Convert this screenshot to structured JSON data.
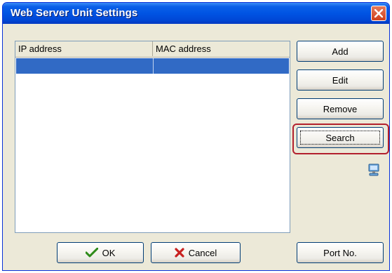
{
  "window": {
    "title": "Web Server Unit Settings"
  },
  "list": {
    "columns": [
      "IP address",
      "MAC address"
    ],
    "rows": [
      {
        "ip": "",
        "mac": "",
        "selected": true
      }
    ]
  },
  "buttons": {
    "add": "Add",
    "edit": "Edit",
    "remove": "Remove",
    "search": "Search",
    "ok": "OK",
    "cancel": "Cancel",
    "port": "Port No."
  },
  "icons": {
    "close": "close-icon",
    "network": "network-computer-icon",
    "ok": "checkmark-icon",
    "cancel": "x-icon"
  },
  "colors": {
    "titlebar": "#0054e3",
    "selection": "#316ac5",
    "highlight_border": "#b3202e"
  }
}
